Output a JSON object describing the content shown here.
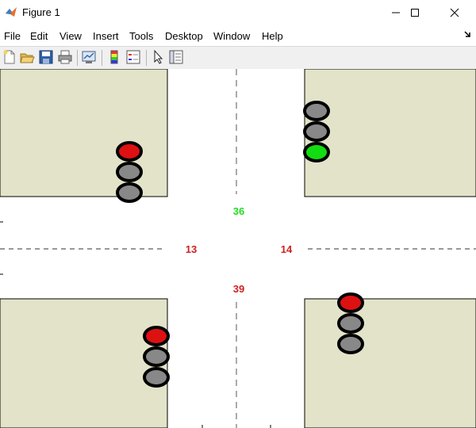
{
  "window": {
    "title": "Figure 1",
    "controls": [
      "minimize",
      "maximize",
      "close"
    ]
  },
  "menu": {
    "items": [
      "File",
      "Edit",
      "View",
      "Insert",
      "Tools",
      "Desktop",
      "Window",
      "Help"
    ]
  },
  "toolbar": {
    "buttons": [
      "new-figure-icon",
      "open-file-icon",
      "save-icon",
      "print-icon",
      "link-plot-icon",
      "colorbar-icon",
      "legend-icon",
      "edit-plot-arrow-icon",
      "property-inspector-icon"
    ]
  },
  "intersection": {
    "colors": {
      "block": "#e3e3c9",
      "road": "#ffffff",
      "red": "#dd1111",
      "green": "#11dd11",
      "off": "#888888",
      "countdown_red": "#cc2222",
      "countdown_green": "#22dd22"
    },
    "countdowns": {
      "north": "36",
      "west": "13",
      "east": "14",
      "south": "39"
    },
    "lights": {
      "top_left": {
        "active": "red",
        "order": [
          "red",
          "off",
          "off"
        ]
      },
      "top_right": {
        "active": "green",
        "order": [
          "off",
          "off",
          "green"
        ]
      },
      "bottom_left": {
        "active": "red",
        "order": [
          "red",
          "off",
          "off"
        ]
      },
      "bottom_right": {
        "active": "red",
        "order": [
          "red",
          "off",
          "off"
        ]
      }
    }
  }
}
